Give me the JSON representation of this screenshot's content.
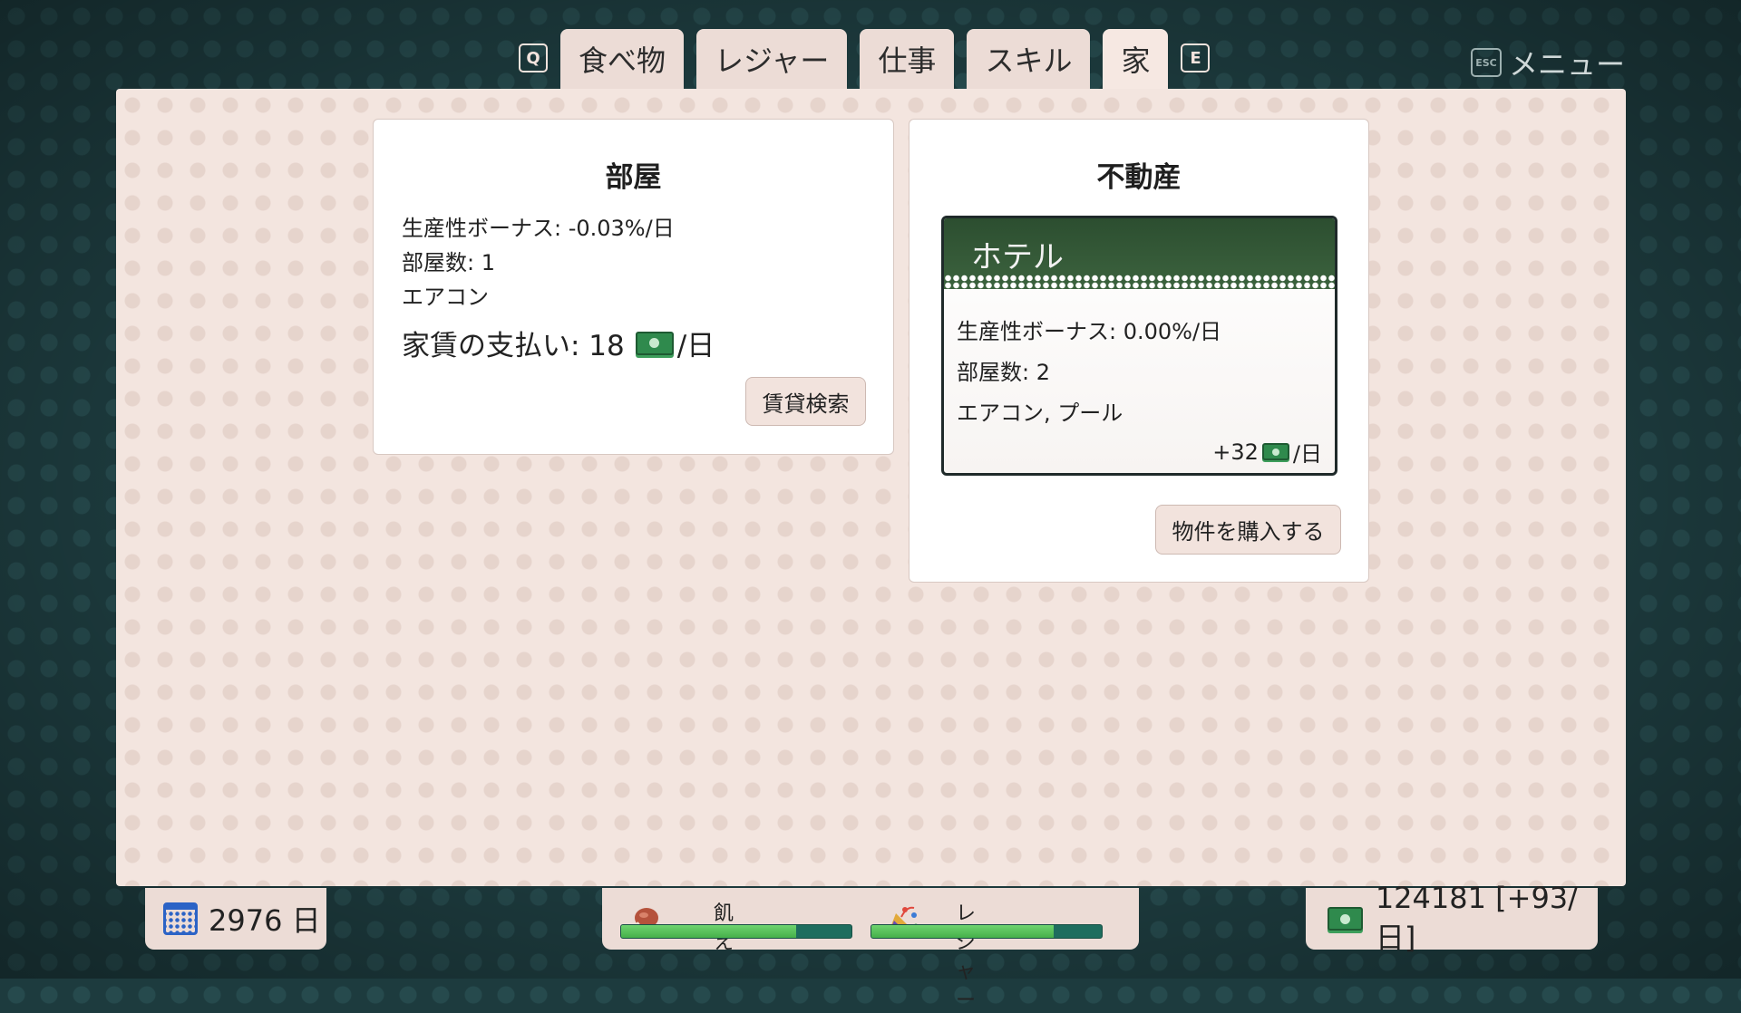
{
  "tabs": {
    "prev_key": "Q",
    "next_key": "E",
    "items": [
      {
        "label": "食べ物"
      },
      {
        "label": "レジャー"
      },
      {
        "label": "仕事"
      },
      {
        "label": "スキル"
      },
      {
        "label": "家"
      }
    ],
    "active": "家"
  },
  "menu": {
    "key": "ESC",
    "label": "メニュー"
  },
  "room_card": {
    "title": "部屋",
    "productivity": "生産性ボーナス: -0.03%/日",
    "rooms": "部屋数: 1",
    "amenities": "エアコン",
    "rent_label": "家賃の支払い: 18",
    "rent_unit": "/日",
    "button": "賃貸検索"
  },
  "realestate_card": {
    "title": "不動産",
    "property": {
      "name": "ホテル",
      "productivity": "生産性ボーナス: 0.00%/日",
      "rooms": "部屋数: 2",
      "amenities": "エアコン, プール",
      "income_prefix": "+32",
      "income_unit": "/日"
    },
    "button": "物件を購入する"
  },
  "hud": {
    "days": "2976 日",
    "hunger_label": "飢え",
    "hunger_level": 0.76,
    "leisure_label": "レジャー",
    "leisure_level": 0.79,
    "funds": "124181 [+93/日]"
  },
  "colors": {
    "background": "#1d3b3e",
    "panel": "#f3e5df",
    "tab": "#ecdcd6",
    "money_green": "#2f8a4d",
    "bar_fill": "#57c25b",
    "bar_track": "#1e6d5e",
    "hotel_header": "#2c4e30"
  }
}
